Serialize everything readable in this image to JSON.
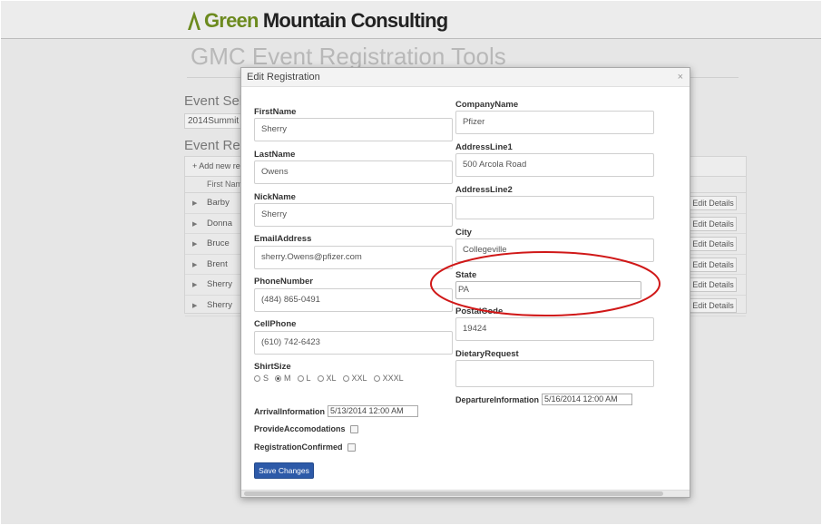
{
  "brand": {
    "logo_word1": "Green",
    "logo_word2": " Mountain Consulting",
    "logo_color": "#6c8a1e"
  },
  "page": {
    "title": "GMC Event Registration Tools",
    "event_section": "Event Sele",
    "event_value": "2014Summit",
    "reg_section": "Event Reg"
  },
  "grid": {
    "toolbar_label": "+ Add new rec",
    "header_first_name": "First Name",
    "rows": [
      {
        "first_name": "Barby",
        "edit_label": "Edit Details"
      },
      {
        "first_name": "Donna",
        "edit_label": "Edit Details"
      },
      {
        "first_name": "Bruce",
        "edit_label": "Edit Details"
      },
      {
        "first_name": "Brent",
        "edit_label": "Edit Details"
      },
      {
        "first_name": "Sherry",
        "edit_label": "Edit Details"
      },
      {
        "first_name": "Sherry",
        "edit_label": "Edit Details"
      }
    ]
  },
  "modal": {
    "title": "Edit Registration",
    "close_label": "×",
    "fields": {
      "first_name": {
        "label": "FirstName",
        "value": "Sherry"
      },
      "last_name": {
        "label": "LastName",
        "value": "Owens"
      },
      "nick_name": {
        "label": "NickName",
        "value": "Sherry"
      },
      "email": {
        "label": "EmailAddress",
        "value": "sherry.Owens@pfizer.com"
      },
      "phone": {
        "label": "PhoneNumber",
        "value": "(484) 865-0491"
      },
      "cell": {
        "label": "CellPhone",
        "value": "(610) 742-6423"
      },
      "company": {
        "label": "CompanyName",
        "value": "Pfizer"
      },
      "address1": {
        "label": "AddressLine1",
        "value": "500 Arcola Road"
      },
      "address2": {
        "label": "AddressLine2",
        "value": ""
      },
      "city": {
        "label": "City",
        "value": "Collegeville"
      },
      "state": {
        "label": "State",
        "value": "PA"
      },
      "postal": {
        "label": "PostalCode",
        "value": "19424"
      },
      "dietary": {
        "label": "DietaryRequest",
        "value": ""
      }
    },
    "shirt_size": {
      "label": "ShirtSize",
      "options": [
        "S",
        "M",
        "L",
        "XL",
        "XXL",
        "XXXL"
      ],
      "selected": "M"
    },
    "arrival": {
      "label": "ArrivalInformation",
      "value": "5/13/2014 12:00 AM"
    },
    "departure": {
      "label": "DepartureInformation",
      "value": "5/16/2014 12:00 AM"
    },
    "provide_accommodations": {
      "label": "ProvideAccomodations",
      "checked": false
    },
    "registration_confirmed": {
      "label": "RegistrationConfirmed",
      "checked": false
    },
    "save_label": "Save Changes"
  },
  "annotation": {
    "shape": "ellipse",
    "color": "#d01818",
    "highlights": "state-field"
  },
  "colors": {
    "primary_button": "#2d5aa8",
    "overlay": "#e6e6e6"
  }
}
